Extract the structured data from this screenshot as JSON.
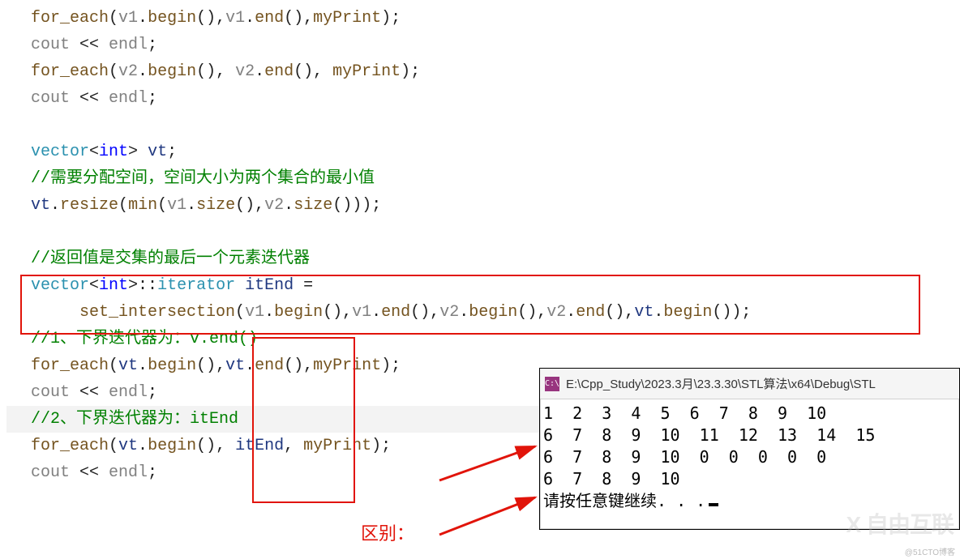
{
  "code": {
    "l01": {
      "fn": "for_each",
      "p1": "v1",
      "m1": "begin",
      "p2": "v1",
      "m2": "end",
      "cb": "myPrint"
    },
    "l02": {
      "obj": "cout",
      "endl": "endl"
    },
    "l03": {
      "fn": "for_each",
      "p1": "v2",
      "m1": "begin",
      "p2": "v2",
      "m2": "end",
      "cb": "myPrint"
    },
    "l04": {
      "obj": "cout",
      "endl": "endl"
    },
    "l05": {
      "kw": "vector",
      "tp": "int",
      "var": "vt"
    },
    "l06": "//需要分配空间，空间大小为两个集合的最小值",
    "l07": {
      "obj": "vt",
      "resize": "resize",
      "min": "min",
      "a": "v1",
      "sz": "size",
      "b": "v2"
    },
    "l08": "//返回值是交集的最后一个元素迭代器",
    "l09": {
      "kw": "vector",
      "tp": "int",
      "iter": "iterator",
      "var": "itEnd"
    },
    "l10": {
      "fn": "set_intersection",
      "a": "v1",
      "b": "v2",
      "t": "vt",
      "begin": "begin",
      "end": "end"
    },
    "l11": "//1、下界迭代器为：v.end()",
    "l12": {
      "fn": "for_each",
      "p": "vt",
      "begin": "begin",
      "end": "end",
      "cb": "myPrint"
    },
    "l13": {
      "obj": "cout",
      "endl": "endl"
    },
    "l14": "//2、下界迭代器为：itEnd",
    "l15": {
      "fn": "for_each",
      "p": "vt",
      "begin": "begin",
      "var": "itEnd",
      "cb": "myPrint"
    },
    "l16": {
      "obj": "cout",
      "endl": "endl"
    }
  },
  "diff_label": "区别：",
  "console": {
    "icon_text": "C:\\",
    "title": "E:\\Cpp_Study\\2023.3月\\23.3.30\\STL算法\\x64\\Debug\\STL",
    "rows": [
      "1  2  3  4  5  6  7  8  9  10",
      "6  7  8  9  10  11  12  13  14  15",
      "6  7  8  9  10  0  0  0  0  0",
      "6  7  8  9  10",
      "请按任意键继续. . ."
    ]
  },
  "watermark_small": "@51CTO博客",
  "watermark_big": "自由互联"
}
